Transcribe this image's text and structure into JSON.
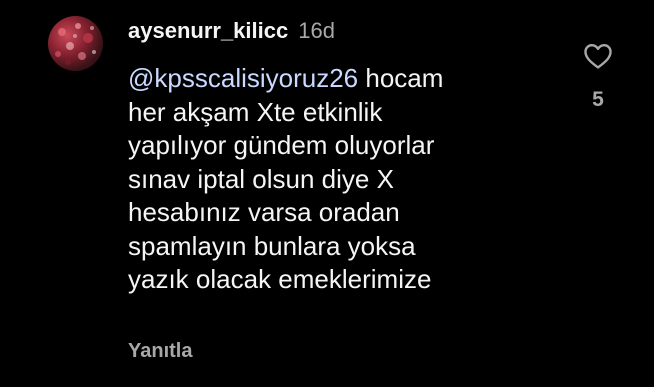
{
  "comment": {
    "username": "aysenurr_kilicc",
    "time": "16d",
    "mention": "@kpsscalisiyoruz26",
    "lines": [
      " hocam",
      "her akşam Xte etkinlik",
      "yapılıyor gündem oluyorlar",
      "sınav iptal olsun diye X",
      "hesabınız varsa oradan",
      "spamlayın bunlara yoksa",
      "yazık olacak emeklerimize"
    ],
    "reply_label": "Yanıtla",
    "like_count": "5"
  },
  "icons": {
    "like": "heart-outline-icon",
    "avatar": "profile-photo"
  },
  "colors": {
    "background": "#000000",
    "text": "#f5f5f5",
    "muted": "#a8a8a8",
    "mention": "#c9d9ff"
  }
}
